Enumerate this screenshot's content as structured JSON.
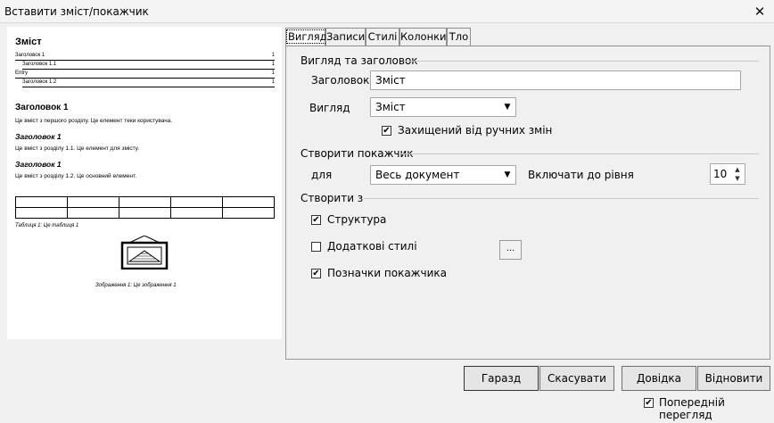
{
  "window": {
    "title": "Вставити зміст/покажчик",
    "close_glyph": "✕"
  },
  "preview": {
    "toc_title": "Зміст",
    "toc_entries": [
      {
        "text": "Заголовок 1",
        "page": "1"
      },
      {
        "text": "Заголовок 1.1",
        "page": "1"
      },
      {
        "text": "Entry",
        "page": "1"
      },
      {
        "text": "Заголовок 1.2",
        "page": "1"
      }
    ],
    "heading1": "Заголовок 1",
    "text1": "Це вміст з першого розділу. Це елемент теки користувача.",
    "heading11": "Заголовок 1",
    "text11": "Це вміст з розділу 1.1. Це елемент для змісту.",
    "heading12": "Заголовок 1",
    "text12": "Це вміст з розділу 1.2. Це основний елемент.",
    "table_caption": "Таблиця 1: Це таблиця 1",
    "image_caption": "Зображення 1: Це зображення 1"
  },
  "tabs": [
    "Вигляд",
    "Записи",
    "Стилі",
    "Колонки",
    "Тло"
  ],
  "active_tab": "Вигляд",
  "type_title": {
    "section_label": "Вигляд та заголовок",
    "title_label": "Заголовок",
    "title_value": "Зміст",
    "type_label": "Вигляд",
    "type_value": "Зміст",
    "protected_label": "Захищений від ручних змін",
    "protected_checked": true
  },
  "create_index": {
    "section_label": "Створити покажчик",
    "for_label": "для",
    "for_value": "Весь документ",
    "evaluate_label": "Включати до рівня",
    "evaluate_value": "10"
  },
  "create_from": {
    "section_label": "Створити з",
    "outline_label": "Структура",
    "outline_checked": true,
    "styles_label": "Додаткові стилі",
    "styles_checked": false,
    "styles_button": "...",
    "marks_label": "Позначки покажчика",
    "marks_checked": true
  },
  "buttons": {
    "ok": "Гаразд",
    "cancel": "Скасувати",
    "help": "Довідка",
    "reset": "Відновити"
  },
  "preview_checkbox": {
    "label": "Попередній перегляд",
    "checked": true
  },
  "icons": {
    "check": "✔",
    "dropdown_arrow": "▼",
    "spin_up": "▲",
    "spin_down": "▼"
  }
}
